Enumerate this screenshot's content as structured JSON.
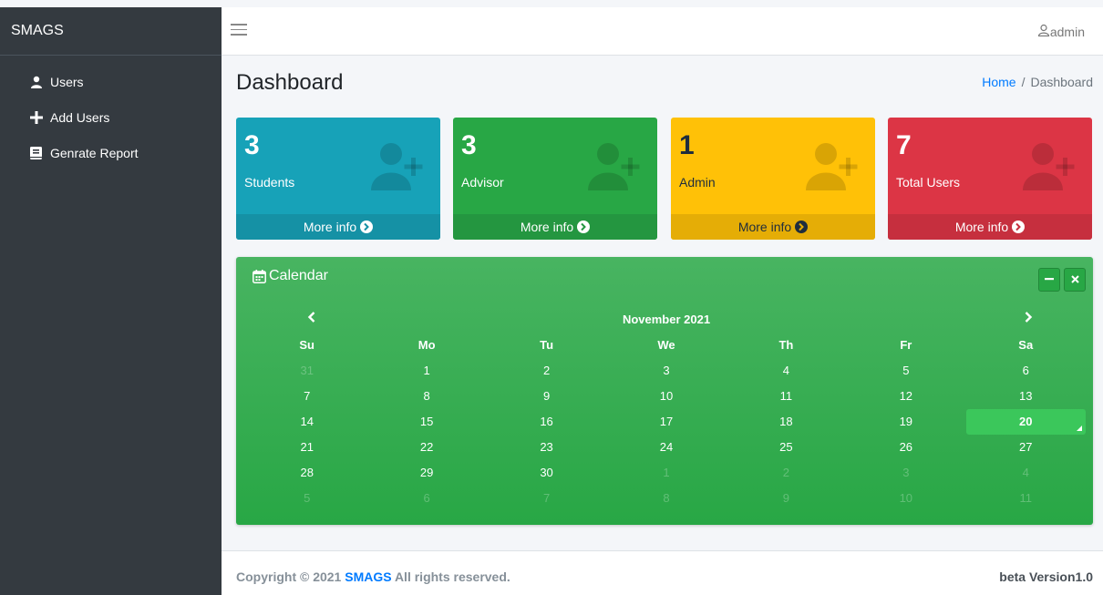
{
  "sidebar": {
    "brand": "SMAGS",
    "items": [
      {
        "label": "Users",
        "icon": "user-icon"
      },
      {
        "label": "Add Users",
        "icon": "plus-icon"
      },
      {
        "label": "Genrate Report",
        "icon": "book-icon"
      }
    ]
  },
  "topbar": {
    "user": "admin"
  },
  "header": {
    "title": "Dashboard",
    "breadcrumb_home": "Home",
    "breadcrumb_sep": "/",
    "breadcrumb_current": "Dashboard"
  },
  "boxes": [
    {
      "count": "3",
      "label": "Students",
      "more": "More info",
      "color": "#17a2b8"
    },
    {
      "count": "3",
      "label": "Advisor",
      "more": "More info",
      "color": "#28a745"
    },
    {
      "count": "1",
      "label": "Admin",
      "more": "More info",
      "color": "#ffc107"
    },
    {
      "count": "7",
      "label": "Total Users",
      "more": "More info",
      "color": "#dc3545"
    }
  ],
  "calendar": {
    "title": "Calendar",
    "month": "November 2021",
    "weekdays": [
      "Su",
      "Mo",
      "Tu",
      "We",
      "Th",
      "Fr",
      "Sa"
    ],
    "weeks": [
      [
        "31",
        "1",
        "2",
        "3",
        "4",
        "5",
        "6"
      ],
      [
        "7",
        "8",
        "9",
        "10",
        "11",
        "12",
        "13"
      ],
      [
        "14",
        "15",
        "16",
        "17",
        "18",
        "19",
        "20"
      ],
      [
        "21",
        "22",
        "23",
        "24",
        "25",
        "26",
        "27"
      ],
      [
        "28",
        "29",
        "30",
        "1",
        "2",
        "3",
        "4"
      ],
      [
        "5",
        "6",
        "7",
        "8",
        "9",
        "10",
        "11"
      ]
    ],
    "selected": "20"
  },
  "footer": {
    "copy_prefix": "Copyright © 2021 ",
    "brand": "SMAGS",
    "copy_suffix": " All rights reserved.",
    "version": "beta Version1.0"
  }
}
